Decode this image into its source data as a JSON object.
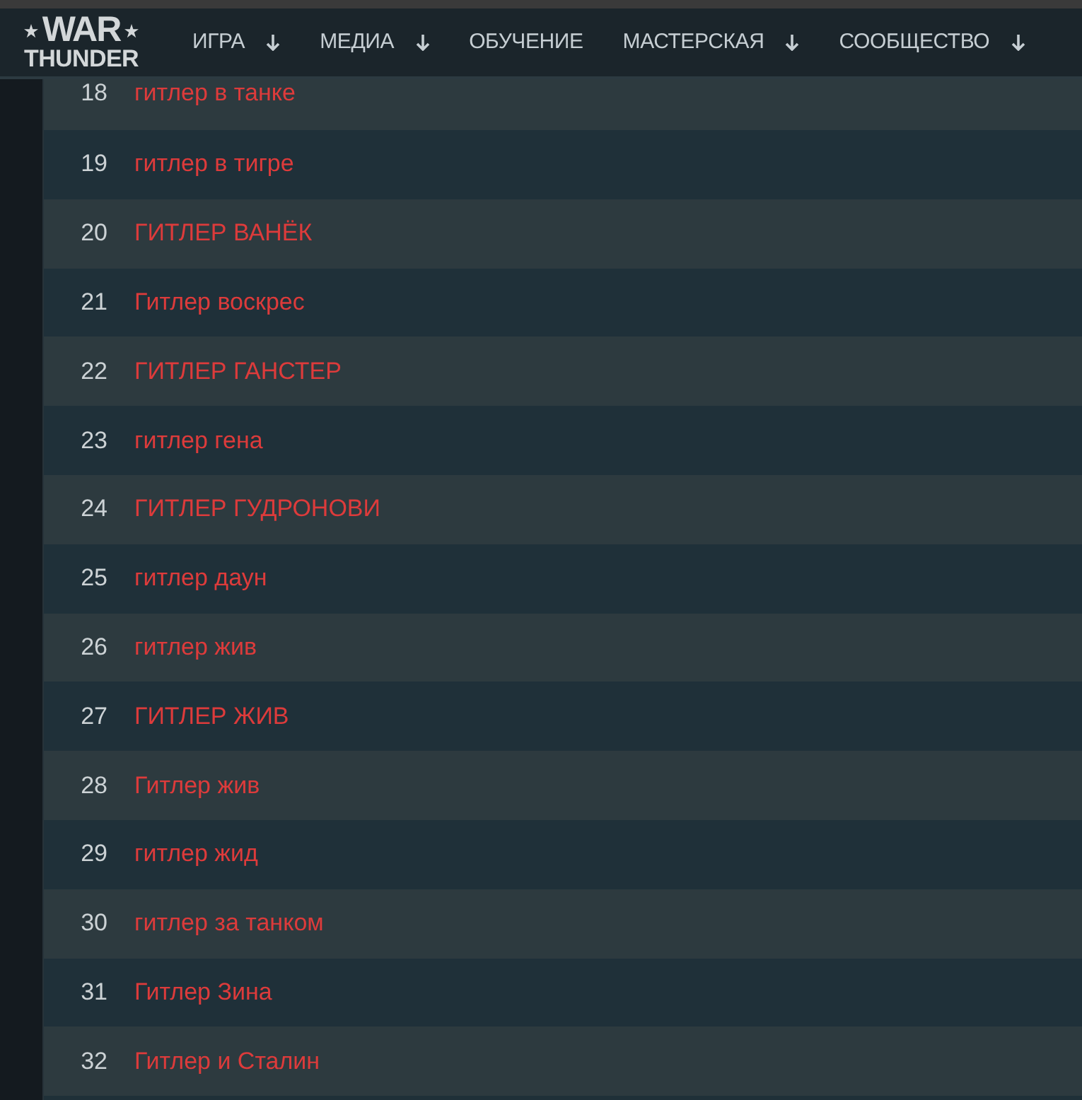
{
  "header": {
    "logo": {
      "line_1": "WAR",
      "line_2": "THUNDER"
    },
    "nav": [
      {
        "label": "ИГРА",
        "dropdown": true
      },
      {
        "label": "МЕДИА",
        "dropdown": true
      },
      {
        "label": "ОБУЧЕНИЕ",
        "dropdown": false
      },
      {
        "label": "МАСТЕРСКАЯ",
        "dropdown": true
      },
      {
        "label": "СООБЩЕСТВО",
        "dropdown": true
      }
    ]
  },
  "rows": [
    {
      "number": "18",
      "text": "гитлер в танке"
    },
    {
      "number": "19",
      "text": "гитлер в тигре"
    },
    {
      "number": "20",
      "text": "ГИТЛЕР ВАНЁК"
    },
    {
      "number": "21",
      "text": "Гитлер воскрес"
    },
    {
      "number": "22",
      "text": "ГИТЛЕР ГАНСТЕР"
    },
    {
      "number": "23",
      "text": "гитлер гена"
    },
    {
      "number": "24",
      "text": "ГИТЛЕР ГУДРОНОВИ"
    },
    {
      "number": "25",
      "text": "гитлер даун"
    },
    {
      "number": "26",
      "text": "гитлер жив"
    },
    {
      "number": "27",
      "text": "ГИТЛЕР ЖИВ"
    },
    {
      "number": "28",
      "text": "Гитлер жив"
    },
    {
      "number": "29",
      "text": "гитлер жид"
    },
    {
      "number": "30",
      "text": "гитлер за танком"
    },
    {
      "number": "31",
      "text": "Гитлер Зина"
    },
    {
      "number": "32",
      "text": "Гитлер и Сталин"
    }
  ]
}
